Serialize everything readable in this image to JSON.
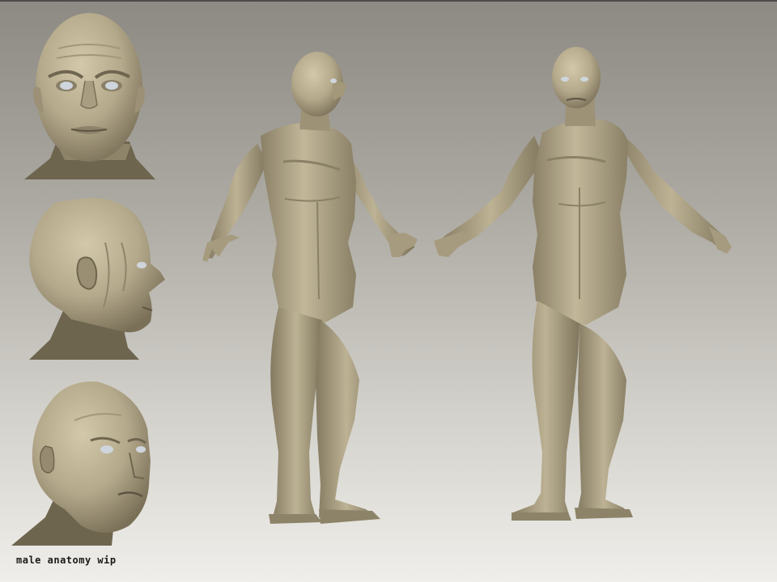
{
  "caption": "male anatomy wip",
  "colors": {
    "clay": "#b8ad90",
    "clay_shadow": "#7d735b",
    "clay_dark": "#5a5240",
    "eye": "#c9d0d8",
    "background_top": "#8d8983",
    "background_bottom": "#efeeea"
  },
  "views": [
    "head-front-view",
    "head-side-view",
    "head-three-quarter-view",
    "body-three-quarter-left-view",
    "body-three-quarter-right-view"
  ]
}
